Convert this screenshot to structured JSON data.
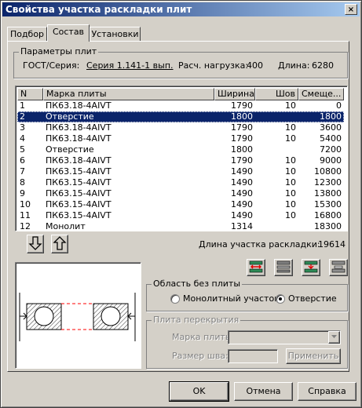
{
  "window": {
    "title": "Свойства участка раскладки плит",
    "close_glyph": "×"
  },
  "tabs": [
    {
      "label": "Подбор"
    },
    {
      "label": "Состав"
    },
    {
      "label": "Установки"
    }
  ],
  "params": {
    "legend": "Параметры плит",
    "gost_label": "ГОСТ/Серия:",
    "gost_value": "Серия 1.141-1 вып.",
    "load_label": "Расч. нагрузка:",
    "load_value": "400",
    "length_label": "Длина:",
    "length_value": "6280"
  },
  "table": {
    "headers": [
      "N",
      "Марка плиты",
      "Ширина",
      "Шов",
      "Смеще..."
    ],
    "selected_index": 1,
    "rows": [
      [
        "1",
        "ПК63.18-4AIVT",
        "1790",
        "10",
        "0"
      ],
      [
        "2",
        "Отверстие",
        "1800",
        "",
        "1800"
      ],
      [
        "3",
        "ПК63.18-4AIVT",
        "1790",
        "10",
        "3600"
      ],
      [
        "4",
        "ПК63.18-4AIVT",
        "1790",
        "10",
        "5400"
      ],
      [
        "5",
        "Отверстие",
        "1800",
        "",
        "7200"
      ],
      [
        "6",
        "ПК63.18-4AIVT",
        "1790",
        "10",
        "9000"
      ],
      [
        "7",
        "ПК63.15-4AIVT",
        "1490",
        "10",
        "10800"
      ],
      [
        "8",
        "ПК63.15-4AIVT",
        "1490",
        "10",
        "12300"
      ],
      [
        "9",
        "ПК63.15-4AIVT",
        "1490",
        "10",
        "13800"
      ],
      [
        "10",
        "ПК63.15-4AIVT",
        "1490",
        "10",
        "15300"
      ],
      [
        "11",
        "ПК63.15-4AIVT",
        "1490",
        "10",
        "16800"
      ],
      [
        "12",
        "Монолит",
        "1314",
        "",
        "18300"
      ]
    ]
  },
  "layout_length": {
    "label": "Длина участка раскладки:",
    "value": "19614"
  },
  "area_without_slab": {
    "legend": "Область без плиты",
    "option_monolith": "Монолитный участок",
    "option_opening": "Отверстие",
    "selected": "opening"
  },
  "floor_slab": {
    "legend": "Плита перекрытия",
    "mark_label": "Марка плиты:",
    "mark_value": "",
    "seam_label": "Размер шва:",
    "seam_value": "",
    "apply_label": "Применить"
  },
  "buttons": {
    "ok": "OK",
    "cancel": "Отмена",
    "help": "Справка"
  },
  "colors": {
    "title_start": "#0a246a",
    "title_end": "#a6caf0",
    "selection": "#0a246a",
    "face": "#d4d0c8",
    "preview_accent": "#ff0000"
  }
}
